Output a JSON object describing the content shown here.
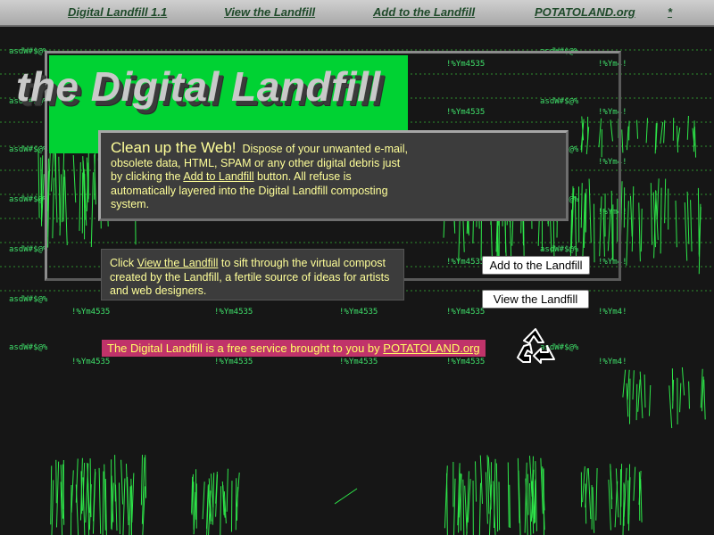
{
  "nav": {
    "items": [
      "Digital Landfill 1.1",
      "View the Landfill",
      "Add to the Landfill",
      "POTATOLAND.org",
      "*"
    ]
  },
  "logo": {
    "title": "the Digital Landfill"
  },
  "garbage_text": {
    "t1": "asdW#$@%",
    "t2": "!%Ym4535",
    "t3": "!%Ym4!"
  },
  "panel_clean": {
    "heading": "Clean up the Web!",
    "text_before": "Dispose of your unwanted e-mail, obsolete data, HTML, SPAM or any other digital debris just by clicking the",
    "link": "Add to Landfill",
    "text_after": "button. All refuse is automatically layered into the Digital Landfill composting system."
  },
  "panel_view": {
    "text_before": "Click",
    "link": "View the Landfill",
    "text_after": "to sift through the virtual compost created by the Landfill, a fertile source of ideas for artists and web designers."
  },
  "buttons": {
    "add": "Add to the Landfill",
    "view": "View the Landfill"
  },
  "footer": {
    "text": "The Digital Landfill is a free service brought to you by",
    "link": "POTATOLAND.org"
  },
  "colors": {
    "nav_bg": "#bdbdbd",
    "logo_bg": "#00d233",
    "panel_bg": "#3c3c3c",
    "panel_text": "#ffff99",
    "footer_bg": "#c0336a",
    "garbage_green": "#3fe06a"
  },
  "icons": {
    "recycle": "recycle-icon"
  }
}
